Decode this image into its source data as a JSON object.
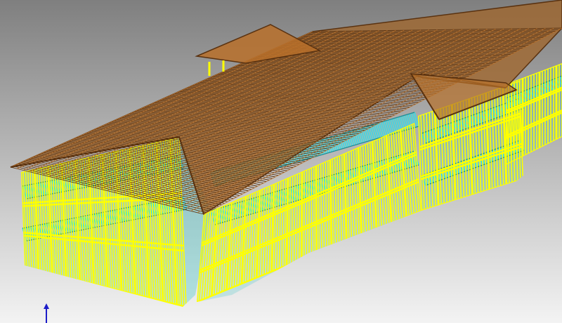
{
  "viewport": {
    "background_top": "#7f7f7f",
    "background_bottom": "#f3f3f3",
    "view": "isometric-3d",
    "render_mode": "wireframe"
  },
  "colors": {
    "studs": "#ffff00",
    "stud_edge": "#8a8a00",
    "floor_joists": "#30e0e8",
    "floor_joist_edge": "#1a8c94",
    "roof_rafters": "#b8702a",
    "roof_edge": "#5a3210",
    "axis": "#1c1cc8"
  },
  "model": {
    "description_visible": false,
    "levels": 3,
    "components": [
      "wall-studs",
      "floor-joists",
      "roof-rafters",
      "dormers"
    ]
  },
  "axis_indicator": {
    "icon": "up-arrow-icon",
    "axis": "z"
  }
}
